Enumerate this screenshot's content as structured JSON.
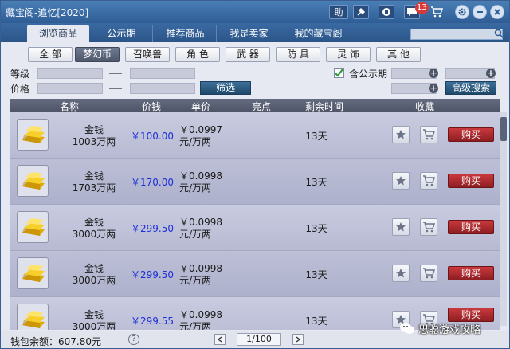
{
  "window": {
    "title": "藏宝阁-追忆[2020]"
  },
  "titlebar": {
    "help_label": "助",
    "message_count": "13"
  },
  "main_tabs": [
    {
      "label": "浏览商品",
      "active": true
    },
    {
      "label": "公示期"
    },
    {
      "label": "推荐商品"
    },
    {
      "label": "我是卖家"
    },
    {
      "label": "我的藏宝阁"
    }
  ],
  "categories": [
    {
      "label": "全 部"
    },
    {
      "label": "梦幻币",
      "active": true
    },
    {
      "label": "召唤兽"
    },
    {
      "label": "角 色"
    },
    {
      "label": "武 器"
    },
    {
      "label": "防 具"
    },
    {
      "label": "灵 饰"
    },
    {
      "label": "其 他"
    }
  ],
  "filters": {
    "level_label": "等级",
    "price_label": "价格",
    "filter_button": "筛选",
    "include_public_label": "含公示期",
    "include_public_checked": true,
    "advanced_search_button": "高级搜索"
  },
  "table": {
    "headers": {
      "name": "名称",
      "price": "价钱",
      "unit_price": "单价",
      "highlight": "亮点",
      "remaining": "剩余时间",
      "favorite": "收藏"
    },
    "rows": [
      {
        "name": "金钱",
        "amount": "1003万两",
        "price": "￥100.00",
        "unit_price": "￥0.0997",
        "unit": "元/万两",
        "remaining": "13天",
        "buy": "购买"
      },
      {
        "name": "金钱",
        "amount": "1703万两",
        "price": "￥170.00",
        "unit_price": "￥0.0998",
        "unit": "元/万两",
        "remaining": "13天",
        "buy": "购买"
      },
      {
        "name": "金钱",
        "amount": "3000万两",
        "price": "￥299.50",
        "unit_price": "￥0.0998",
        "unit": "元/万两",
        "remaining": "13天",
        "buy": "购买"
      },
      {
        "name": "金钱",
        "amount": "3000万两",
        "price": "￥299.50",
        "unit_price": "￥0.0998",
        "unit": "元/万两",
        "remaining": "13天",
        "buy": "购买"
      },
      {
        "name": "金钱",
        "amount": "3000万两",
        "price": "￥299.55",
        "unit_price": "￥0.0998",
        "unit": "元/万两",
        "remaining": "13天",
        "buy": "购买"
      }
    ]
  },
  "footer": {
    "wallet_label": "钱包余额：",
    "wallet_value": "607.80元",
    "help": "?",
    "page": "1/100"
  },
  "watermark": {
    "text": "思聪游戏攻略"
  },
  "colors": {
    "accent": "#2e5d94",
    "price": "#1d2fd8",
    "buy": "#b2292e"
  }
}
